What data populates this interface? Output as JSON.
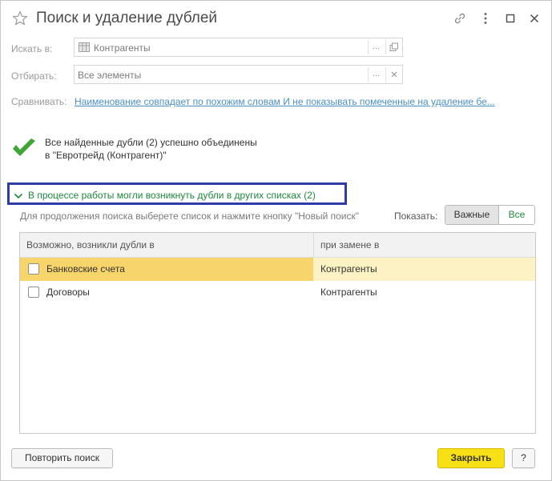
{
  "window": {
    "title": "Поиск и удаление дублей"
  },
  "form": {
    "search_in_label": "Искать в:",
    "search_in_value": "Контрагенты",
    "filter_label": "Отбирать:",
    "filter_value": "Все элементы",
    "compare_label": "Сравнивать:",
    "compare_link": "Наименование совпадает по похожим словам И не показывать помеченные на удаление бе..."
  },
  "result": {
    "line1": "Все найденные дубли (2) успешно объединены",
    "line2": "в \"Евротрейд (Контрагент)\""
  },
  "group": {
    "title": "В процессе работы могли возникнуть дубли в других списках (2)",
    "hint": "Для продолжения поиска выберете список и нажмите кнопку \"Новый поиск\"",
    "show_label": "Показать:",
    "show_options": [
      "Важные",
      "Все"
    ],
    "show_selected": "Важные"
  },
  "table": {
    "columns": [
      "Возможно, возникли дубли в",
      "при замене в"
    ],
    "rows": [
      {
        "list": "Банковские счета",
        "replace": "Контрагенты",
        "checked": false,
        "selected": true
      },
      {
        "list": "Договоры",
        "replace": "Контрагенты",
        "checked": false,
        "selected": false
      }
    ]
  },
  "buttons": {
    "repeat_search": "Повторить поиск",
    "close": "Закрыть",
    "help": "?"
  },
  "icons": {
    "favorite": "star-icon",
    "link": "link-icon",
    "more": "more-vertical-icon",
    "maximize": "maximize-icon",
    "close": "close-icon",
    "catalog": "table-icon",
    "success": "checkmark-icon",
    "expand": "chevron-down-icon"
  },
  "colors": {
    "accent_green": "#1e8a3c",
    "link_blue": "#4a90c8",
    "highlight_border": "#2f3ba8",
    "primary_button": "#f7e016",
    "selected_row": "#f8d56a"
  }
}
